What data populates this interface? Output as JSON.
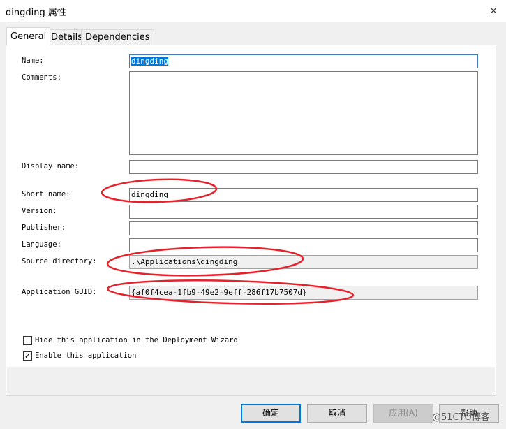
{
  "window": {
    "title": "dingding 属性"
  },
  "tabs": [
    {
      "label": "General",
      "active": true
    },
    {
      "label": "Details",
      "active": false
    },
    {
      "label": "Dependencies",
      "active": false
    }
  ],
  "fields": {
    "name": {
      "label": "Name:",
      "value": "dingding"
    },
    "comments": {
      "label": "Comments:",
      "value": ""
    },
    "display_name": {
      "label": "Display name:",
      "value": ""
    },
    "short_name": {
      "label": "Short name:",
      "value": "dingding"
    },
    "version": {
      "label": "Version:",
      "value": ""
    },
    "publisher": {
      "label": "Publisher:",
      "value": ""
    },
    "language": {
      "label": "Language:",
      "value": ""
    },
    "source_directory": {
      "label": "Source directory:",
      "value": ".\\Applications\\dingding"
    },
    "application_guid": {
      "label": "Application GUID:",
      "value": "{af0f4cea-1fb9-49e2-9eff-286f17b7507d}"
    }
  },
  "checkboxes": [
    {
      "label": "Hide this application in the Deployment Wizard",
      "checked": false,
      "mark": ""
    },
    {
      "label": "Enable this application",
      "checked": true,
      "mark": "✓"
    }
  ],
  "buttons": {
    "ok": "确定",
    "cancel": "取消",
    "apply": "应用(A)",
    "help": "帮助"
  },
  "watermark": "@51CTO博客",
  "colors": {
    "annotation": "#e8202a",
    "selection": "#0078d7"
  },
  "icons": {
    "close": "×"
  }
}
